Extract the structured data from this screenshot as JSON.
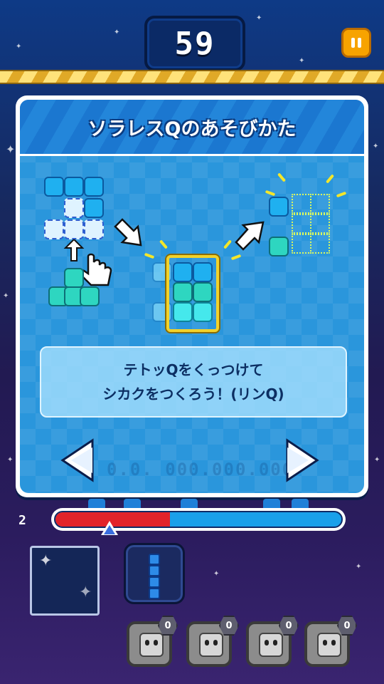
{
  "hud": {
    "score": "59",
    "level": "2",
    "progress": 0.4
  },
  "tutorial": {
    "title": "ソラレスQのあそびかた",
    "line1": "テトッQをくっつけて",
    "line2": "シカクをつくろう！(リンQ)",
    "ghost": "0.0. 000.000.000"
  },
  "characters": [
    {
      "count": "0"
    },
    {
      "count": "0"
    },
    {
      "count": "0"
    },
    {
      "count": "0"
    }
  ],
  "colors": {
    "accent": "#2a96dc",
    "gold": "#f2d22a",
    "pause": "#f7a300",
    "bar_red": "#e2232a",
    "bar_blue": "#1aa0ea"
  },
  "icons": {
    "pause": "pause-icon",
    "prev": "arrow-left-icon",
    "next": "arrow-right-icon",
    "cursor": "hand-pointer-icon"
  }
}
